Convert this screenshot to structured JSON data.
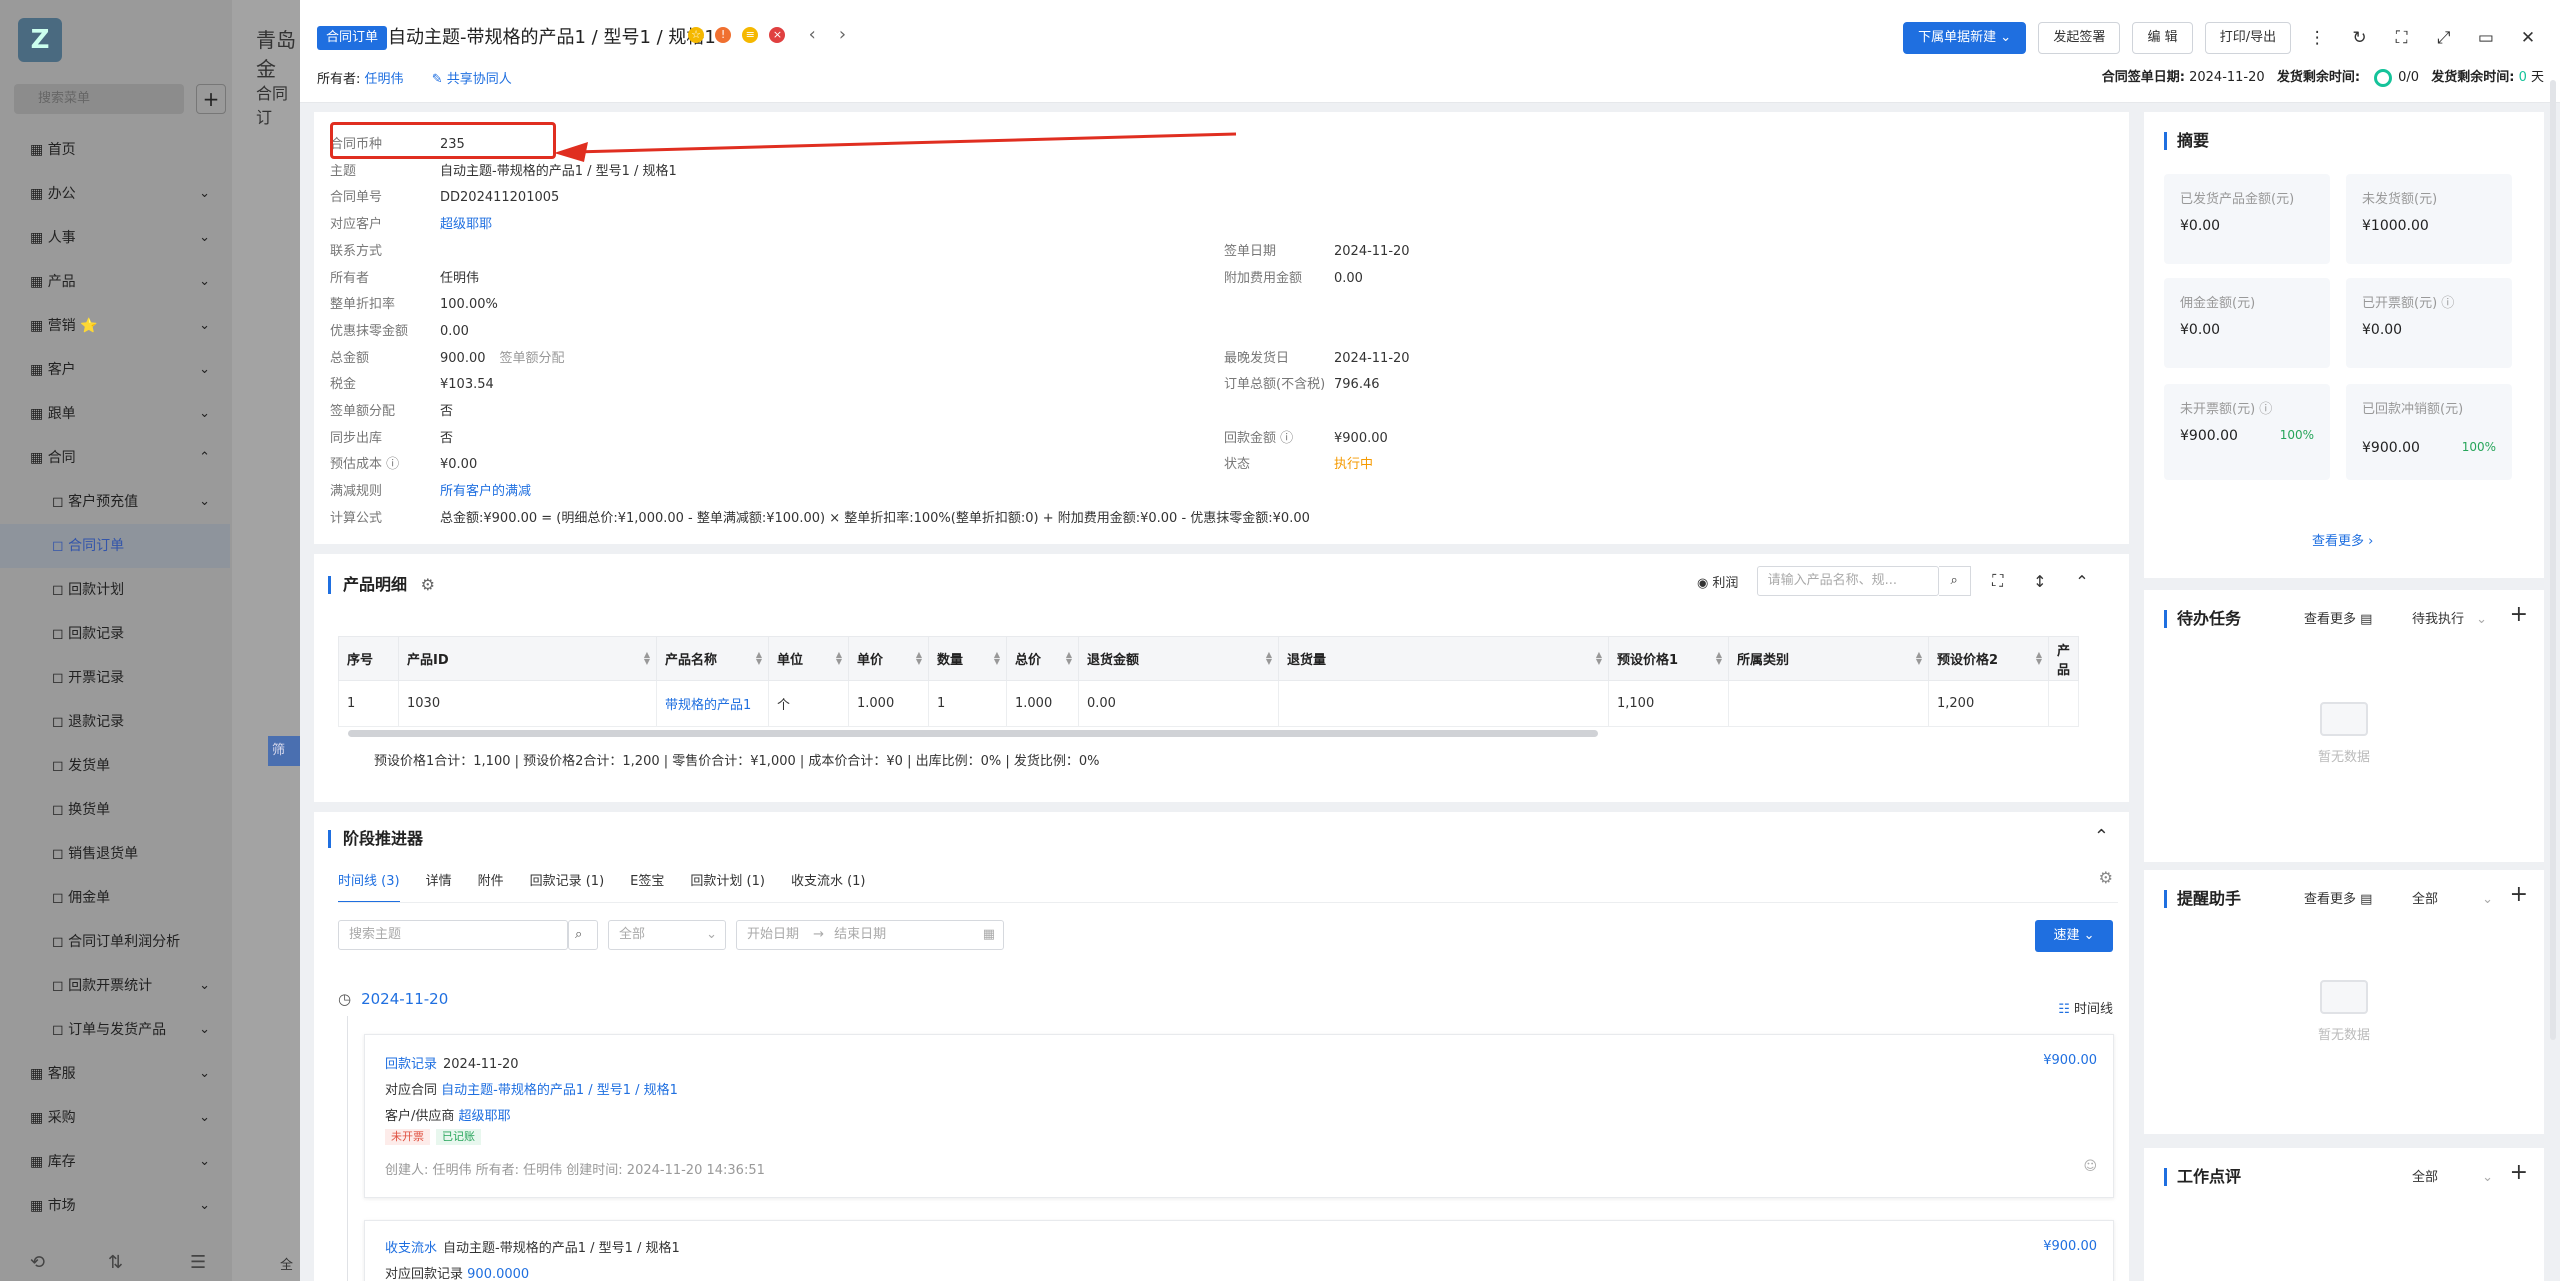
{
  "background": {
    "search_placeholder": "搜索菜单",
    "breadcrumb_top": "青岛金",
    "breadcrumb_sub": "合同订",
    "filter_btn": "筛",
    "total_label": "全",
    "nav": [
      {
        "label": "首页",
        "icon": "home-icon"
      },
      {
        "label": "办公",
        "icon": "office-icon",
        "arrow": "⌄"
      },
      {
        "label": "人事",
        "icon": "people-icon",
        "arrow": "⌄"
      },
      {
        "label": "产品",
        "icon": "product-icon",
        "arrow": "⌄"
      },
      {
        "label": "营销 ⭐",
        "icon": "marketing-icon",
        "arrow": "⌄"
      },
      {
        "label": "客户",
        "icon": "customer-icon",
        "arrow": "⌄"
      },
      {
        "label": "跟单",
        "icon": "follow-icon",
        "arrow": "⌄"
      },
      {
        "label": "合同",
        "icon": "contract-icon",
        "arrow": "⌃",
        "active": true
      },
      {
        "label": "客户预充值",
        "sub": true,
        "arrow": "⌄"
      },
      {
        "label": "合同订单",
        "sub": true,
        "selected": true
      },
      {
        "label": "回款计划",
        "sub": true
      },
      {
        "label": "回款记录",
        "sub": true
      },
      {
        "label": "开票记录",
        "sub": true
      },
      {
        "label": "退款记录",
        "sub": true
      },
      {
        "label": "发货单",
        "sub": true
      },
      {
        "label": "换货单",
        "sub": true
      },
      {
        "label": "销售退货单",
        "sub": true
      },
      {
        "label": "佣金单",
        "sub": true
      },
      {
        "label": "合同订单利润分析",
        "sub": true
      },
      {
        "label": "回款开票统计",
        "sub": true,
        "arrow": "⌄"
      },
      {
        "label": "订单与发货产品",
        "sub": true,
        "arrow": "⌄"
      },
      {
        "label": "客服",
        "icon": "service-icon",
        "arrow": "⌄"
      },
      {
        "label": "采购",
        "icon": "purchase-icon",
        "arrow": "⌄"
      },
      {
        "label": "库存",
        "icon": "stock-icon",
        "arrow": "⌄"
      },
      {
        "label": "市场",
        "icon": "market-icon",
        "arrow": "⌄"
      }
    ]
  },
  "header": {
    "tag": "合同订单",
    "title": "自动主题-带规格的产品1 / 型号1 / 规格1",
    "owner_label": "所有者:",
    "owner_value": "任明伟",
    "share_label": "共享协同人",
    "buttons": {
      "new_sub": "下属单据新建",
      "sign": "发起签署",
      "edit": "编 辑",
      "print": "打印/导出"
    },
    "sign_date_label": "合同签单日期:",
    "sign_date": "2024-11-20",
    "ship_remain_label": "发货剩余时间:",
    "ship_ratio": "0/0",
    "ship_remain_label2": "发货剩余时间:",
    "ship_days": "0",
    "ship_days_unit": "天"
  },
  "info": {
    "left": [
      {
        "k": "合同币种",
        "v": "235"
      },
      {
        "k": "主题",
        "v": "自动主题-带规格的产品1 / 型号1 / 规格1"
      },
      {
        "k": "合同单号",
        "v": "DD202411201005"
      },
      {
        "k": "对应客户",
        "v": "超级耶耶",
        "link": true
      },
      {
        "k": "联系方式",
        "v": ""
      },
      {
        "k": "所有者",
        "v": "任明伟"
      },
      {
        "k": "整单折扣率",
        "v": "100.00%"
      },
      {
        "k": "优惠抹零金额",
        "v": "0.00"
      },
      {
        "k": "总金额",
        "v": "900.00",
        "extra": "签单额分配"
      },
      {
        "k": "税金",
        "v": "¥103.54"
      },
      {
        "k": "签单额分配",
        "v": "否"
      },
      {
        "k": "同步出库",
        "v": "否"
      },
      {
        "k": "预估成本 ⓘ",
        "v": "¥0.00"
      },
      {
        "k": "满减规则",
        "v": "所有客户的满减",
        "link": true
      },
      {
        "k": "计算公式",
        "v": "总金额:¥900.00 = (明细总价:¥1,000.00 - 整单满减额:¥100.00) × 整单折扣率:100%(整单折扣额:0) + 附加费用金额:¥0.00 - 优惠抹零金额:¥0.00"
      }
    ],
    "right": [
      {
        "k": "签单日期",
        "v": "2024-11-20",
        "row": 4
      },
      {
        "k": "附加费用金额",
        "v": "0.00",
        "row": 5
      },
      {
        "k": "最晚发货日",
        "v": "2024-11-20",
        "row": 8
      },
      {
        "k": "订单总额(不含税)",
        "v": "796.46",
        "row": 9
      },
      {
        "k": "回款金额 ⓘ",
        "v": "¥900.00",
        "row": 11
      },
      {
        "k": "状态",
        "v": "执行中",
        "row": 12,
        "orange": true
      }
    ]
  },
  "products": {
    "title": "产品明细",
    "profit_label": "利润",
    "search_placeholder": "请输入产品名称、规...",
    "columns": [
      "序号",
      "产品ID",
      "产品名称",
      "单位",
      "单价",
      "数量",
      "总价",
      "退货金额",
      "退货量",
      "预设价格1",
      "所属类别",
      "预设价格2",
      "产品"
    ],
    "rows": [
      [
        "1",
        "1030",
        "带规格的产品1",
        "个",
        "1.000",
        "1",
        "1.000",
        "0.00",
        "",
        "1,100",
        "",
        "1,200",
        ""
      ]
    ],
    "summary": "预设价格1合计：1,100 |   预设价格2合计：1,200 |   零售价合计：¥1,000 |   成本价合计：¥0 |   出库比例：0% |   发货比例：0%"
  },
  "stage": {
    "title": "阶段推进器",
    "tabs": [
      "时间线 (3)",
      "详情",
      "附件",
      "回款记录 (1)",
      "E签宝",
      "回款计划 (1)",
      "收支流水 (1)"
    ],
    "filters": {
      "search_placeholder": "搜索主题",
      "all": "全部",
      "start_placeholder": "开始日期",
      "end_placeholder": "结束日期"
    },
    "quick_new": "速建",
    "date": "2024-11-20",
    "timeline_label": "时间线",
    "events": [
      {
        "type": "回款记录",
        "date": "2024-11-20",
        "amount": "¥900.00",
        "line2_label": "对应合同",
        "line2_value": "自动主题-带规格的产品1 / 型号1 / 规格1",
        "line3_label": "客户/供应商",
        "line3_value": "超级耶耶",
        "pill1": "未开票",
        "pill2": "已记账",
        "meta": "创建人: 任明伟    所有者: 任明伟    创建时间: 2024-11-20 14:36:51"
      },
      {
        "type": "收支流水",
        "title": "自动主题-带规格的产品1 / 型号1 / 规格1",
        "amount": "¥900.00",
        "line2_label": "对应回款记录",
        "line2_value": "900.0000"
      }
    ]
  },
  "sidebar": {
    "summary": {
      "title": "摘要",
      "cards": [
        {
          "label": "已发货产品金额(元)",
          "value": "¥0.00"
        },
        {
          "label": "未发货额(元)",
          "value": "¥1000.00"
        },
        {
          "label": "佣金金额(元)",
          "value": "¥0.00"
        },
        {
          "label": "已开票额(元) ⓘ",
          "value": "¥0.00"
        },
        {
          "label": "未开票额(元) ⓘ",
          "value": "¥900.00",
          "pct": "100%"
        },
        {
          "label": "已回款冲销额(元)",
          "value": "¥900.00",
          "pct": "100%"
        }
      ],
      "more": "查看更多 ›"
    },
    "todo": {
      "title": "待办任务",
      "more": "查看更多",
      "filter": "待我执行",
      "empty": "暂无数据"
    },
    "reminder": {
      "title": "提醒助手",
      "more": "查看更多",
      "filter": "全部",
      "empty": "暂无数据"
    },
    "review": {
      "title": "工作点评",
      "filter": "全部"
    }
  },
  "colors": {
    "primary": "#1f6fe0",
    "highlight": "#e02e20",
    "success": "#27a55a",
    "warning": "#f59a00"
  }
}
